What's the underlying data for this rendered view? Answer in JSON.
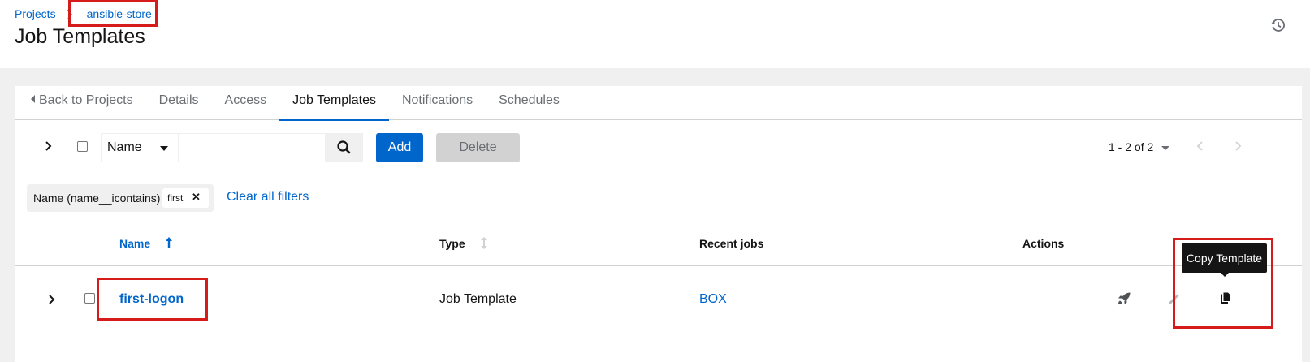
{
  "breadcrumb": {
    "parent": "Projects",
    "current": "ansible-store"
  },
  "page": {
    "title": "Job Templates"
  },
  "tabs": [
    {
      "label": "Back to Projects"
    },
    {
      "label": "Details"
    },
    {
      "label": "Access"
    },
    {
      "label": "Job Templates",
      "active": true
    },
    {
      "label": "Notifications"
    },
    {
      "label": "Schedules"
    }
  ],
  "toolbar": {
    "filter_field": "Name",
    "search_value": "",
    "add_label": "Add",
    "delete_label": "Delete",
    "pagination": {
      "range": "1 - 2",
      "of_label": "of",
      "total": "2"
    }
  },
  "filters": {
    "category": "Name (name__icontains)",
    "chip": "first",
    "clear_label": "Clear all filters"
  },
  "table": {
    "columns": {
      "name": "Name",
      "type": "Type",
      "recent_jobs": "Recent jobs",
      "actions": "Actions"
    },
    "rows": [
      {
        "name": "first-logon",
        "type": "Job Template",
        "recent_jobs": "BOX"
      }
    ]
  },
  "tooltip": {
    "text": "Copy Template"
  },
  "colors": {
    "accent": "#0066cc",
    "highlight": "#d61b1b"
  },
  "icons": [
    "history-icon",
    "angle-right-icon",
    "search-icon",
    "angle-left-icon",
    "sort-up-icon",
    "sort-icon",
    "rocket-icon",
    "pencil-icon",
    "copy-icon",
    "times-icon"
  ]
}
